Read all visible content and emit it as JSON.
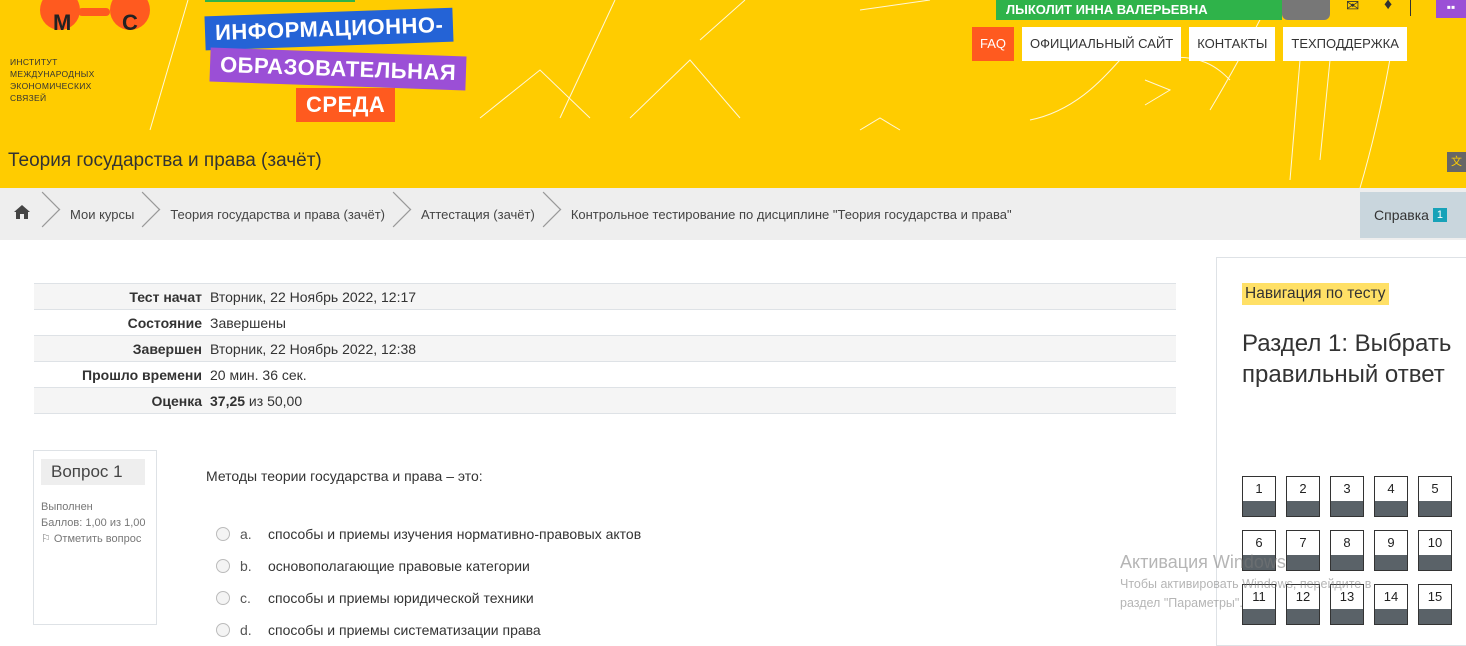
{
  "header": {
    "logo": {
      "letters": [
        "М",
        "С"
      ],
      "org_lines": [
        "ИНСТИТУТ",
        "МЕЖДУНАРОДНЫХ",
        "ЭКОНОМИЧЕСКИХ",
        "СВЯЗЕЙ"
      ]
    },
    "brand": {
      "line1": "ИНФОРМАЦИОННО-",
      "line2": "ОБРАЗОВАТЕЛЬНАЯ",
      "line3": "СРЕДА"
    },
    "user_name": "ЛЫКОЛИТ ИННА ВАЛЕРЬЕВНА",
    "nav": [
      "FAQ",
      "ОФИЦИАЛЬНЫЙ САЙТ",
      "КОНТАКТЫ",
      "ТЕХПОДДЕРЖКА"
    ],
    "course_title": "Теория государства и права (зачёт)",
    "colors": {
      "yellow": "#ffcc00",
      "blue": "#2463d6",
      "purple": "#9b4fd6",
      "orange": "#ff5a1f",
      "green": "#2fb34a"
    }
  },
  "breadcrumb": {
    "home_icon": "home-icon",
    "items": [
      "Мои курсы",
      "Теория государства и права (зачёт)",
      "Аттестация (зачёт)",
      "Контрольное тестирование по дисциплине \"Теория государства и права\""
    ],
    "help_label": "Справка",
    "help_badge": "1"
  },
  "summary": [
    {
      "label": "Тест начат",
      "value": "Вторник, 22 Ноябрь 2022, 12:17"
    },
    {
      "label": "Состояние",
      "value": "Завершены"
    },
    {
      "label": "Завершен",
      "value": "Вторник, 22 Ноябрь 2022, 12:38"
    },
    {
      "label": "Прошло времени",
      "value": "20 мин. 36 сек."
    },
    {
      "label": "Оценка",
      "value_bold": "37,25",
      "value": " из 50,00"
    }
  ],
  "question": {
    "number_label": "Вопрос 1",
    "status": "Выполнен",
    "points": "Баллов: 1,00 из 1,00",
    "flag_label": "Отметить вопрос",
    "text": "Методы теории государства и права – это:",
    "answers": [
      {
        "letter": "a.",
        "text": "способы и приемы изучения нормативно-правовых актов"
      },
      {
        "letter": "b.",
        "text": "основополагающие правовые категории"
      },
      {
        "letter": "c.",
        "text": "способы и приемы юридической техники"
      },
      {
        "letter": "d.",
        "text": "способы и приемы систематизации права"
      }
    ]
  },
  "nav_panel": {
    "title": "Навигация по тесту",
    "section_title": "Раздел 1: Выбрать правильный ответ",
    "buttons": [
      "1",
      "2",
      "3",
      "4",
      "5",
      "6",
      "7",
      "8",
      "9",
      "10",
      "11",
      "12",
      "13",
      "14",
      "15"
    ]
  },
  "watermark": {
    "line1": "Активация Windows",
    "line2": "Чтобы активировать Windows, перейдите в",
    "line3": "раздел \"Параметры\"."
  }
}
